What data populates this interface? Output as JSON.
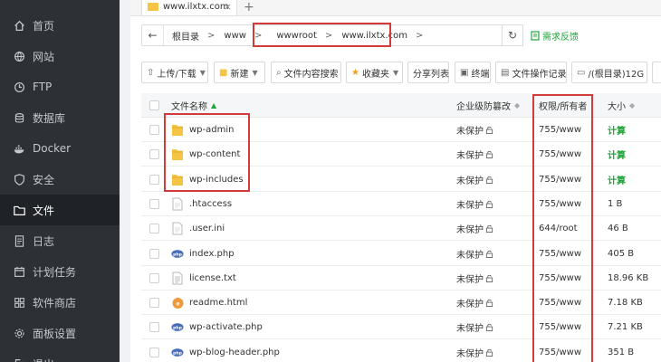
{
  "sidebar": {
    "items": [
      {
        "label": "首页",
        "icon": "home-icon",
        "active": false
      },
      {
        "label": "网站",
        "icon": "globe-icon",
        "active": false
      },
      {
        "label": "FTP",
        "icon": "ftp-icon",
        "active": false
      },
      {
        "label": "数据库",
        "icon": "database-icon",
        "active": false
      },
      {
        "label": "Docker",
        "icon": "docker-icon",
        "active": false
      },
      {
        "label": "安全",
        "icon": "shield-icon",
        "active": false
      },
      {
        "label": "文件",
        "icon": "folder-icon",
        "active": true
      },
      {
        "label": "日志",
        "icon": "log-icon",
        "active": false
      },
      {
        "label": "计划任务",
        "icon": "calendar-icon",
        "active": false
      },
      {
        "label": "软件商店",
        "icon": "store-icon",
        "active": false
      },
      {
        "label": "面板设置",
        "icon": "gear-icon",
        "active": false
      },
      {
        "label": "退出",
        "icon": "exit-icon",
        "active": false
      }
    ]
  },
  "tabs": {
    "active_label": "www.ilxtx.com",
    "close_symbol": "×",
    "add_symbol": "+"
  },
  "address": {
    "back_symbol": "←",
    "crumbs": [
      "根目录",
      "www",
      "wwwroot",
      "www.ilxtx.com"
    ],
    "refresh_symbol": "↻",
    "feedback_label": "需求反馈"
  },
  "toolbar": {
    "upload_label": "上传/下载",
    "new_label": "新建",
    "search_label": "文件内容搜索",
    "favorites_label": "收藏夹",
    "share_label": "分享列表",
    "terminal_label": "终端",
    "ops_log_label": "文件操作记录",
    "disk_label": "/(根目录)12G"
  },
  "table": {
    "headers": {
      "name": "文件名称",
      "protection": "企业级防篡改",
      "permission": "权限/所有者",
      "size": "大小"
    },
    "rows": [
      {
        "name": "wp-admin",
        "type": "folder",
        "protection": "未保护",
        "permission": "755/www",
        "size": "计算"
      },
      {
        "name": "wp-content",
        "type": "folder",
        "protection": "未保护",
        "permission": "755/www",
        "size": "计算"
      },
      {
        "name": "wp-includes",
        "type": "folder",
        "protection": "未保护",
        "permission": "755/www",
        "size": "计算"
      },
      {
        "name": ".htaccess",
        "type": "file",
        "protection": "未保护",
        "permission": "755/www",
        "size": "1 B"
      },
      {
        "name": ".user.ini",
        "type": "file",
        "protection": "未保护",
        "permission": "644/root",
        "size": "46 B"
      },
      {
        "name": "index.php",
        "type": "php",
        "protection": "未保护",
        "permission": "755/www",
        "size": "405 B"
      },
      {
        "name": "license.txt",
        "type": "text",
        "protection": "未保护",
        "permission": "755/www",
        "size": "18.96 KB"
      },
      {
        "name": "readme.html",
        "type": "html",
        "protection": "未保护",
        "permission": "755/www",
        "size": "7.18 KB"
      },
      {
        "name": "wp-activate.php",
        "type": "php",
        "protection": "未保护",
        "permission": "755/www",
        "size": "7.21 KB"
      },
      {
        "name": "wp-blog-header.php",
        "type": "php",
        "protection": "未保护",
        "permission": "755/www",
        "size": "351 B"
      }
    ]
  },
  "colors": {
    "sidebar_bg": "#2d3136",
    "sidebar_active": "#1f2226",
    "accent_green": "#20a53a",
    "highlight_red": "#d33a3a",
    "folder_yellow": "#f6c445",
    "php_blue": "#4a6fb8"
  }
}
